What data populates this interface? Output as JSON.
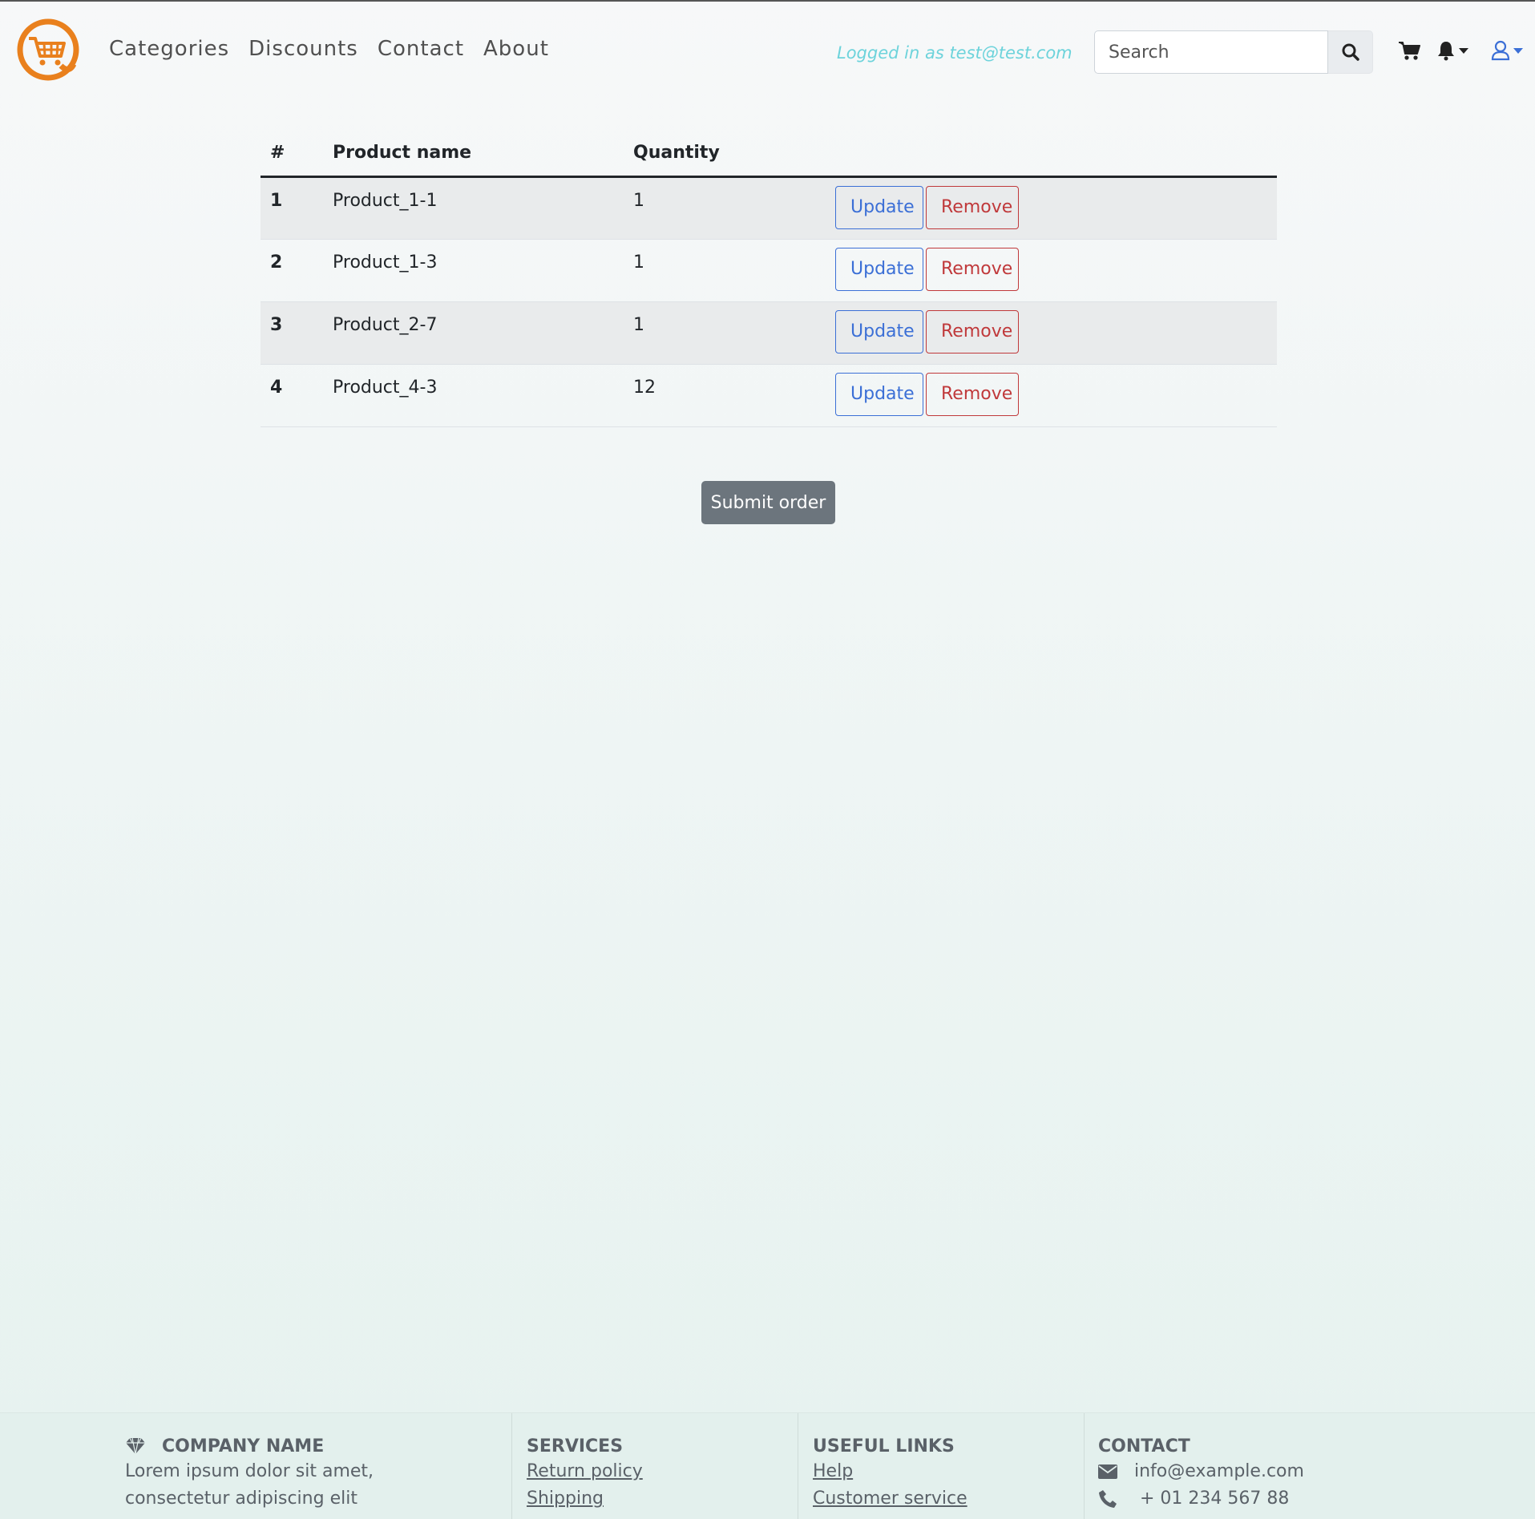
{
  "nav": {
    "links": [
      "Categories",
      "Discounts",
      "Contact",
      "About"
    ],
    "logged_in": "Logged in as test@test.com",
    "search_placeholder": "Search",
    "logo_color": "#e9801d",
    "icons": [
      "search-icon",
      "cart-icon",
      "bell-icon",
      "user-icon"
    ]
  },
  "table": {
    "headers": [
      "#",
      "Product name",
      "Quantity",
      ""
    ],
    "rows": [
      {
        "idx": "1",
        "name": "Product_1-1",
        "qty": "1"
      },
      {
        "idx": "2",
        "name": "Product_1-3",
        "qty": "1"
      },
      {
        "idx": "3",
        "name": "Product_2-7",
        "qty": "1"
      },
      {
        "idx": "4",
        "name": "Product_4-3",
        "qty": "12"
      }
    ],
    "update_label": "Update",
    "remove_label": "Remove"
  },
  "submit_label": "Submit order",
  "footer": {
    "company": {
      "title": "COMPANY NAME",
      "text1": "Lorem ipsum dolor sit amet,",
      "text2": "consectetur adipiscing elit"
    },
    "services": {
      "title": "SERVICES",
      "links": [
        "Return policy",
        "Shipping"
      ]
    },
    "useful": {
      "title": "USEFUL LINKS",
      "links": [
        "Help",
        "Customer service"
      ]
    },
    "contact": {
      "title": "CONTACT",
      "email": "info@example.com",
      "phone": "+ 01 234 567 88"
    }
  },
  "colors": {
    "primary": "#3b6fd6",
    "danger": "#c0393b",
    "secondary": "#6c757d",
    "accent_text": "#6dd3db"
  }
}
